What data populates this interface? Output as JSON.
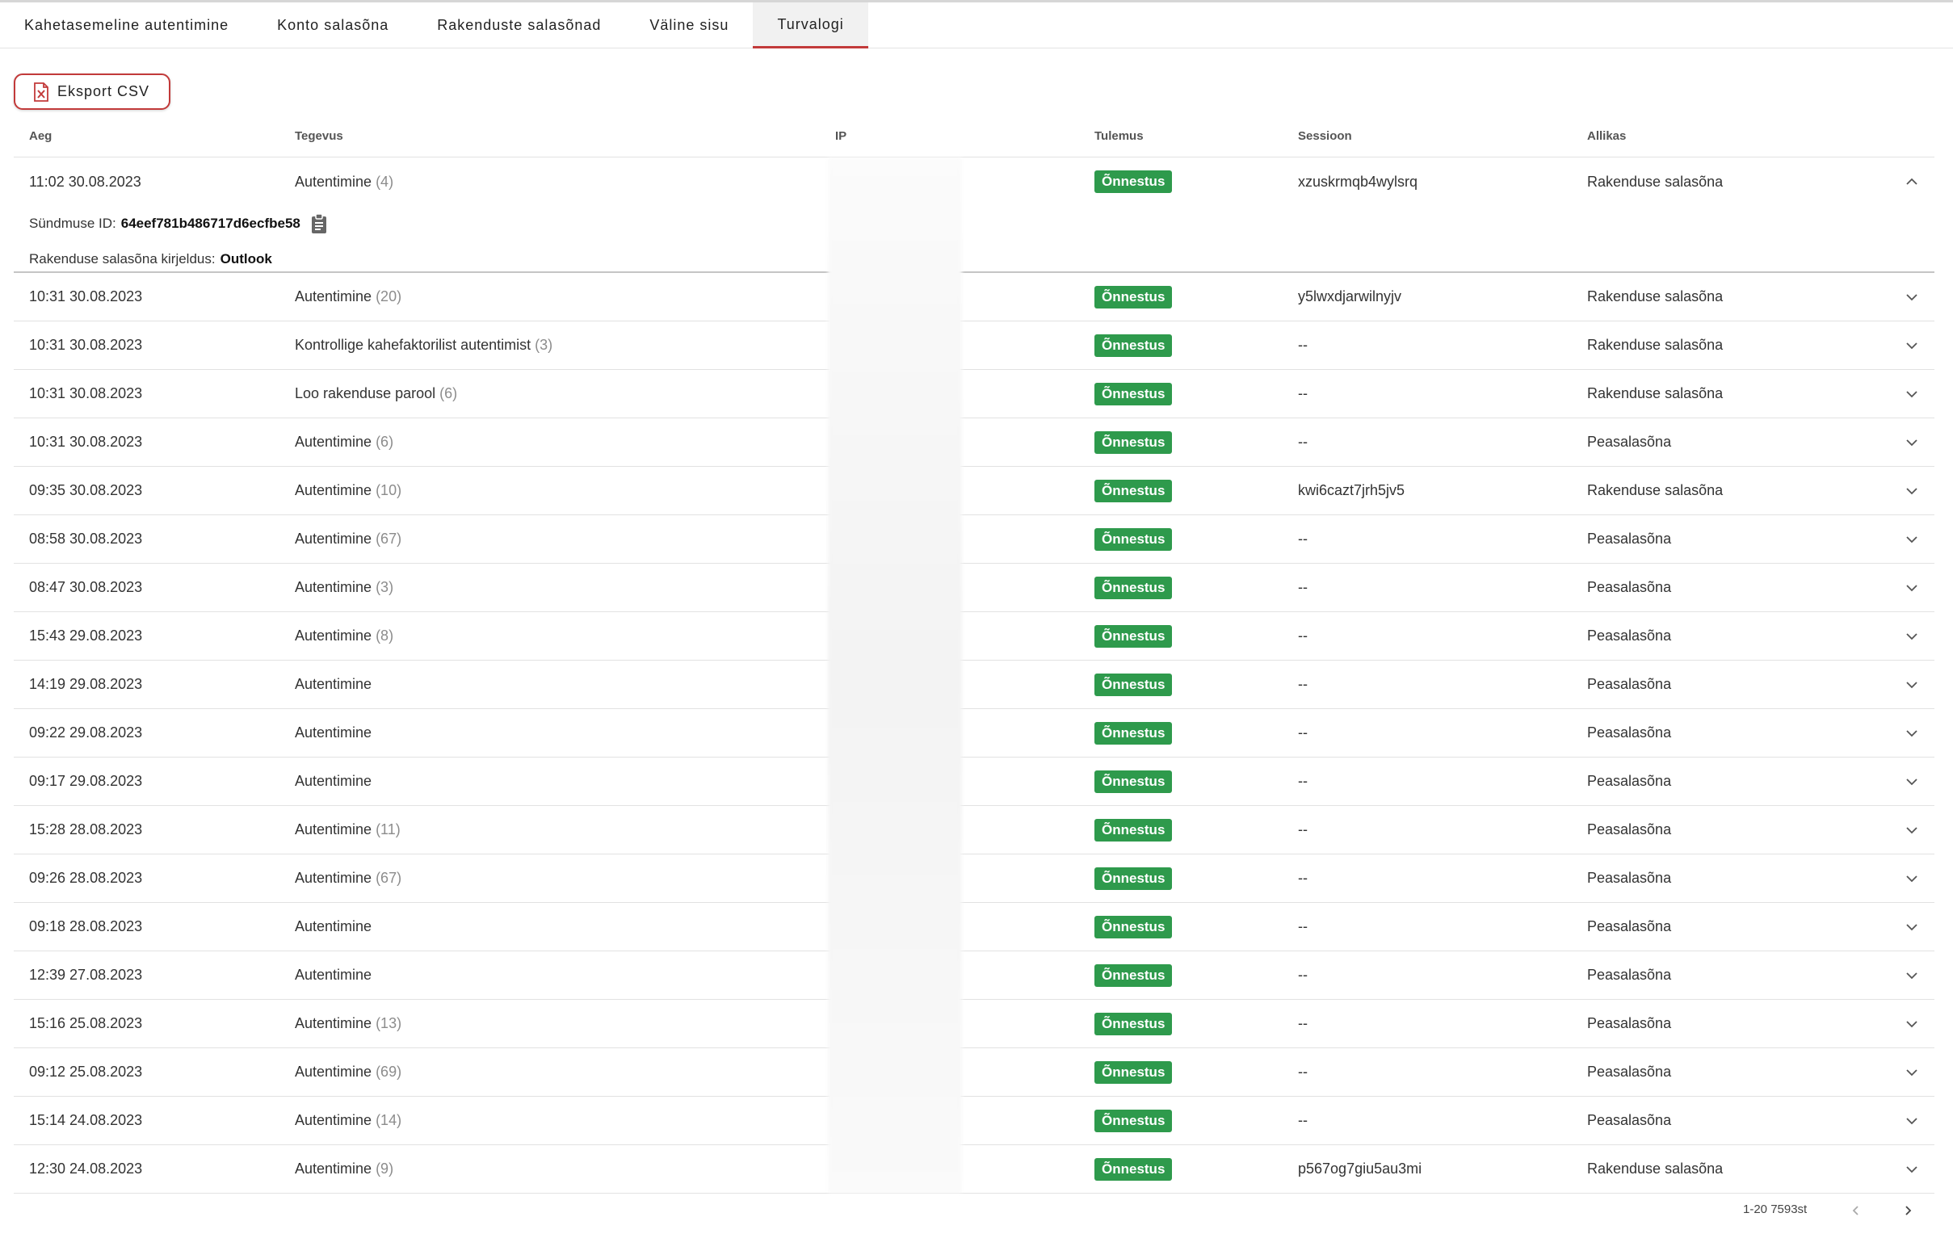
{
  "tabs": [
    {
      "label": "Kahetasemeline autentimine"
    },
    {
      "label": "Konto salasõna"
    },
    {
      "label": "Rakenduste salasõnad"
    },
    {
      "label": "Väline sisu"
    },
    {
      "label": "Turvalogi"
    }
  ],
  "active_tab": "Turvalogi",
  "export_label": "Eksport CSV",
  "columns": {
    "time": "Aeg",
    "action": "Tegevus",
    "ip": "IP",
    "result": "Tulemus",
    "session": "Sessioon",
    "source": "Allikas"
  },
  "rows": [
    {
      "time": "11:02 30.08.2023",
      "action": "Autentimine",
      "count": "(4)",
      "result": "Õnnestus",
      "session": "xzuskrmqb4wylsrq",
      "source": "Rakenduse salasõna"
    },
    {
      "time": "10:31 30.08.2023",
      "action": "Autentimine",
      "count": "(20)",
      "result": "Õnnestus",
      "session": "y5lwxdjarwilnyjv",
      "source": "Rakenduse salasõna"
    },
    {
      "time": "10:31 30.08.2023",
      "action": "Kontrollige kahefaktorilist autentimist",
      "count": "(3)",
      "result": "Õnnestus",
      "session": "--",
      "source": "Rakenduse salasõna"
    },
    {
      "time": "10:31 30.08.2023",
      "action": "Loo rakenduse parool",
      "count": "(6)",
      "result": "Õnnestus",
      "session": "--",
      "source": "Rakenduse salasõna"
    },
    {
      "time": "10:31 30.08.2023",
      "action": "Autentimine",
      "count": "(6)",
      "result": "Õnnestus",
      "session": "--",
      "source": "Peasalasõna"
    },
    {
      "time": "09:35 30.08.2023",
      "action": "Autentimine",
      "count": "(10)",
      "result": "Õnnestus",
      "session": "kwi6cazt7jrh5jv5",
      "source": "Rakenduse salasõna"
    },
    {
      "time": "08:58 30.08.2023",
      "action": "Autentimine",
      "count": "(67)",
      "result": "Õnnestus",
      "session": "--",
      "source": "Peasalasõna"
    },
    {
      "time": "08:47 30.08.2023",
      "action": "Autentimine",
      "count": "(3)",
      "result": "Õnnestus",
      "session": "--",
      "source": "Peasalasõna"
    },
    {
      "time": "15:43 29.08.2023",
      "action": "Autentimine",
      "count": "(8)",
      "result": "Õnnestus",
      "session": "--",
      "source": "Peasalasõna"
    },
    {
      "time": "14:19 29.08.2023",
      "action": "Autentimine",
      "count": "",
      "result": "Õnnestus",
      "session": "--",
      "source": "Peasalasõna"
    },
    {
      "time": "09:22 29.08.2023",
      "action": "Autentimine",
      "count": "",
      "result": "Õnnestus",
      "session": "--",
      "source": "Peasalasõna"
    },
    {
      "time": "09:17 29.08.2023",
      "action": "Autentimine",
      "count": "",
      "result": "Õnnestus",
      "session": "--",
      "source": "Peasalasõna"
    },
    {
      "time": "15:28 28.08.2023",
      "action": "Autentimine",
      "count": "(11)",
      "result": "Õnnestus",
      "session": "--",
      "source": "Peasalasõna"
    },
    {
      "time": "09:26 28.08.2023",
      "action": "Autentimine",
      "count": "(67)",
      "result": "Õnnestus",
      "session": "--",
      "source": "Peasalasõna"
    },
    {
      "time": "09:18 28.08.2023",
      "action": "Autentimine",
      "count": "",
      "result": "Õnnestus",
      "session": "--",
      "source": "Peasalasõna"
    },
    {
      "time": "12:39 27.08.2023",
      "action": "Autentimine",
      "count": "",
      "result": "Õnnestus",
      "session": "--",
      "source": "Peasalasõna"
    },
    {
      "time": "15:16 25.08.2023",
      "action": "Autentimine",
      "count": "(13)",
      "result": "Õnnestus",
      "session": "--",
      "source": "Peasalasõna"
    },
    {
      "time": "09:12 25.08.2023",
      "action": "Autentimine",
      "count": "(69)",
      "result": "Õnnestus",
      "session": "--",
      "source": "Peasalasõna"
    },
    {
      "time": "15:14 24.08.2023",
      "action": "Autentimine",
      "count": "(14)",
      "result": "Õnnestus",
      "session": "--",
      "source": "Peasalasõna"
    },
    {
      "time": "12:30 24.08.2023",
      "action": "Autentimine",
      "count": "(9)",
      "result": "Õnnestus",
      "session": "p567og7giu5au3mi",
      "source": "Rakenduse salasõna"
    }
  ],
  "detail": {
    "event_id_label": "Sündmuse ID:",
    "event_id": "64eef781b486717d6ecfbe58",
    "description_label": "Rakenduse salasõna kirjeldus:",
    "description": "Outlook"
  },
  "pagination": {
    "range": "1-20 7593st"
  },
  "colors": {
    "accent": "#c23a3a",
    "success": "#2e9a4c"
  },
  "icons": {
    "export": "excel-file-icon",
    "copy": "clipboard-icon",
    "expand": "chevron-down-icon",
    "collapse": "chevron-up-icon",
    "prev": "chevron-left-icon",
    "next": "chevron-right-icon"
  }
}
